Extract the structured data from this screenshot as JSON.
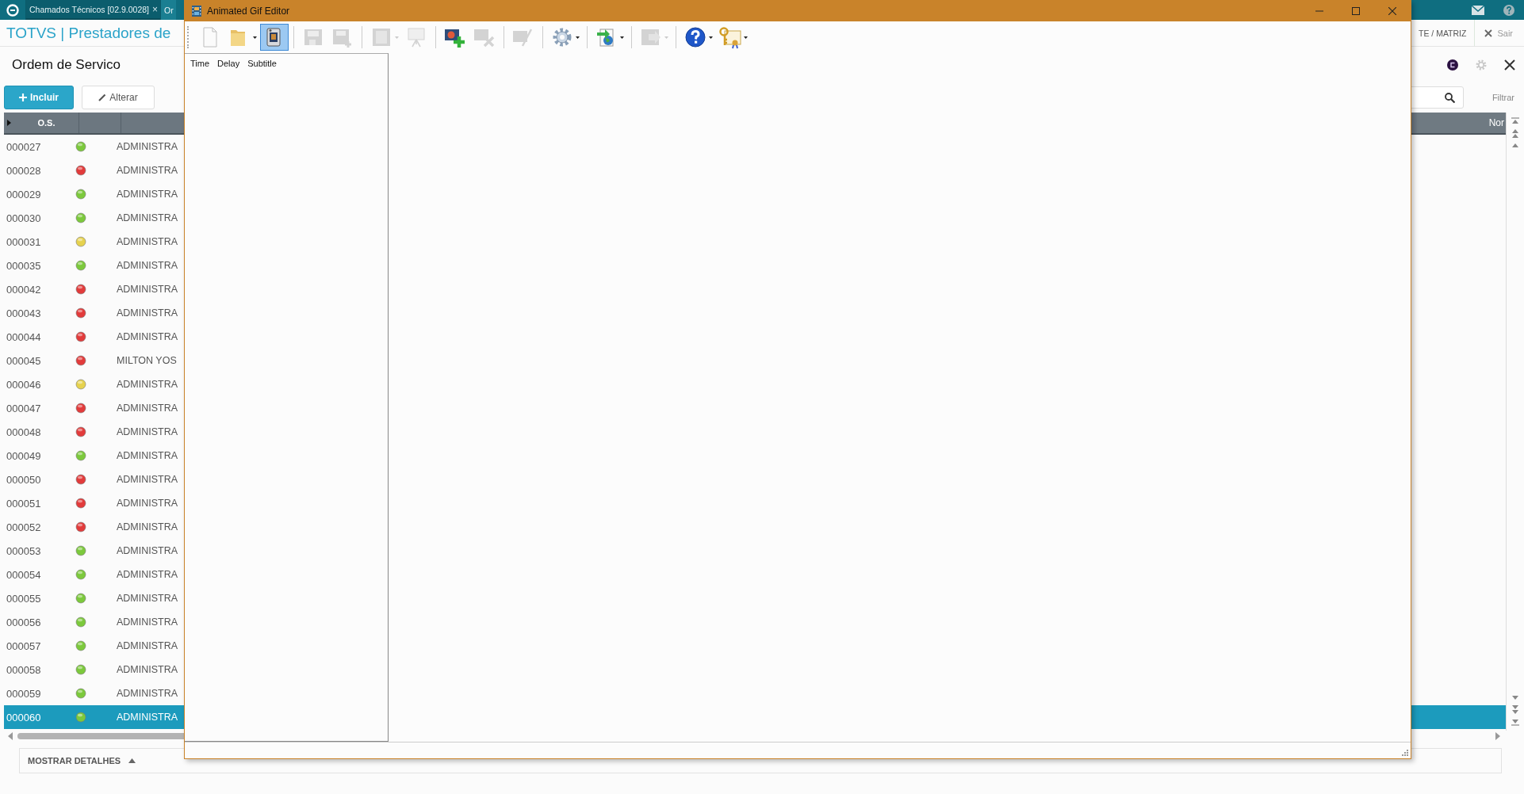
{
  "app_tabs": [
    {
      "label": "Chamados Técnicos [02.9.0028]",
      "close": "×",
      "selected": true
    },
    {
      "label": "Or",
      "selected": false
    }
  ],
  "header": {
    "brand": "TOTVS | Prestadores de",
    "company": "TE / MATRIZ",
    "exit": "Sair"
  },
  "page": {
    "title": "Ordem de Servico",
    "actions": [
      {
        "label": "Incluir",
        "primary": true
      },
      {
        "label": "Alterar",
        "primary": false
      }
    ],
    "filter": "Filtrar"
  },
  "grid": {
    "columns": [
      "O.S.",
      "Nor"
    ],
    "rows": [
      {
        "os": "000027",
        "name": "ADMINISTRA",
        "color": "#7cc93c",
        "selected": false
      },
      {
        "os": "000028",
        "name": "ADMINISTRA",
        "color": "#e23b3b",
        "selected": false
      },
      {
        "os": "000029",
        "name": "ADMINISTRA",
        "color": "#7cc93c",
        "selected": false
      },
      {
        "os": "000030",
        "name": "ADMINISTRA",
        "color": "#7cc93c",
        "selected": false
      },
      {
        "os": "000031",
        "name": "ADMINISTRA",
        "color": "#e6d24e",
        "selected": false
      },
      {
        "os": "000035",
        "name": "ADMINISTRA",
        "color": "#7cc93c",
        "selected": false
      },
      {
        "os": "000042",
        "name": "ADMINISTRA",
        "color": "#e23b3b",
        "selected": false
      },
      {
        "os": "000043",
        "name": "ADMINISTRA",
        "color": "#e23b3b",
        "selected": false
      },
      {
        "os": "000044",
        "name": "ADMINISTRA",
        "color": "#e23b3b",
        "selected": false
      },
      {
        "os": "000045",
        "name": "MILTON YOS",
        "color": "#e23b3b",
        "selected": false
      },
      {
        "os": "000046",
        "name": "ADMINISTRA",
        "color": "#e6d24e",
        "selected": false
      },
      {
        "os": "000047",
        "name": "ADMINISTRA",
        "color": "#e23b3b",
        "selected": false
      },
      {
        "os": "000048",
        "name": "ADMINISTRA",
        "color": "#e23b3b",
        "selected": false
      },
      {
        "os": "000049",
        "name": "ADMINISTRA",
        "color": "#7cc93c",
        "selected": false
      },
      {
        "os": "000050",
        "name": "ADMINISTRA",
        "color": "#e23b3b",
        "selected": false
      },
      {
        "os": "000051",
        "name": "ADMINISTRA",
        "color": "#e23b3b",
        "selected": false
      },
      {
        "os": "000052",
        "name": "ADMINISTRA",
        "color": "#e23b3b",
        "selected": false
      },
      {
        "os": "000053",
        "name": "ADMINISTRA",
        "color": "#7cc93c",
        "selected": false
      },
      {
        "os": "000054",
        "name": "ADMINISTRA",
        "color": "#7cc93c",
        "selected": false
      },
      {
        "os": "000055",
        "name": "ADMINISTRA",
        "color": "#7cc93c",
        "selected": false
      },
      {
        "os": "000056",
        "name": "ADMINISTRA",
        "color": "#7cc93c",
        "selected": false
      },
      {
        "os": "000057",
        "name": "ADMINISTRA",
        "color": "#7cc93c",
        "selected": false
      },
      {
        "os": "000058",
        "name": "ADMINISTRA",
        "color": "#7cc93c",
        "selected": false
      },
      {
        "os": "000059",
        "name": "ADMINISTRA",
        "color": "#7cc93c",
        "selected": false
      },
      {
        "os": "000060",
        "name": "ADMINISTRA",
        "color": "#7cc93c",
        "selected": true
      }
    ]
  },
  "details": {
    "label": "MOSTRAR DETALHES",
    "expanded": false
  },
  "gif_editor": {
    "title": "Animated Gif Editor",
    "toolbar": [
      [
        {
          "kind": "new",
          "disabled": false,
          "selected": false,
          "dropdown": false
        },
        {
          "kind": "open",
          "disabled": false,
          "selected": false,
          "dropdown": true
        },
        {
          "kind": "camera",
          "disabled": false,
          "selected": true,
          "dropdown": false
        }
      ],
      [
        {
          "kind": "save",
          "disabled": true,
          "selected": false,
          "dropdown": false
        },
        {
          "kind": "save-plus",
          "disabled": true,
          "selected": false,
          "dropdown": false
        }
      ],
      [
        {
          "kind": "film",
          "disabled": true,
          "selected": false,
          "dropdown": true
        },
        {
          "kind": "easel",
          "disabled": true,
          "selected": false,
          "dropdown": false
        }
      ],
      [
        {
          "kind": "image-add",
          "disabled": false,
          "selected": false,
          "dropdown": false
        },
        {
          "kind": "image-delete",
          "disabled": true,
          "selected": false,
          "dropdown": false
        }
      ],
      [
        {
          "kind": "edit",
          "disabled": true,
          "selected": false,
          "dropdown": false
        }
      ],
      [
        {
          "kind": "gear",
          "disabled": false,
          "selected": false,
          "dropdown": true
        }
      ],
      [
        {
          "kind": "export",
          "disabled": false,
          "selected": false,
          "dropdown": true
        }
      ],
      [
        {
          "kind": "film-arrow",
          "disabled": true,
          "selected": false,
          "dropdown": true
        }
      ],
      [
        {
          "kind": "help",
          "disabled": false,
          "selected": false,
          "dropdown": true
        },
        {
          "kind": "certificate",
          "disabled": false,
          "selected": false,
          "dropdown": true
        }
      ]
    ],
    "frame_columns": [
      "Time",
      "Delay",
      "Subtitle"
    ]
  }
}
